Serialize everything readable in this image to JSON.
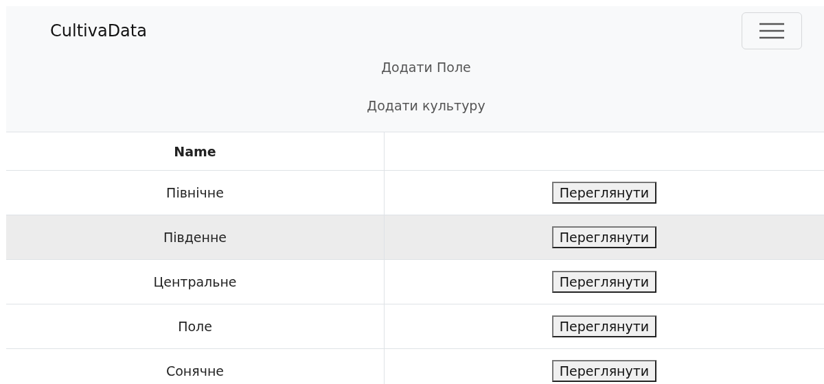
{
  "navbar": {
    "brand": "CultivaData",
    "links": [
      "Додати Поле",
      "Додати культуру"
    ]
  },
  "table": {
    "columns": [
      "Name"
    ],
    "rows": [
      {
        "name": "Північне",
        "action": "Переглянути",
        "highlighted": false
      },
      {
        "name": "Південне",
        "action": "Переглянути",
        "highlighted": true
      },
      {
        "name": "Центральне",
        "action": "Переглянути",
        "highlighted": false
      },
      {
        "name": "Поле",
        "action": "Переглянути",
        "highlighted": false
      },
      {
        "name": "Сонячне",
        "action": "Переглянути",
        "highlighted": false
      }
    ]
  }
}
